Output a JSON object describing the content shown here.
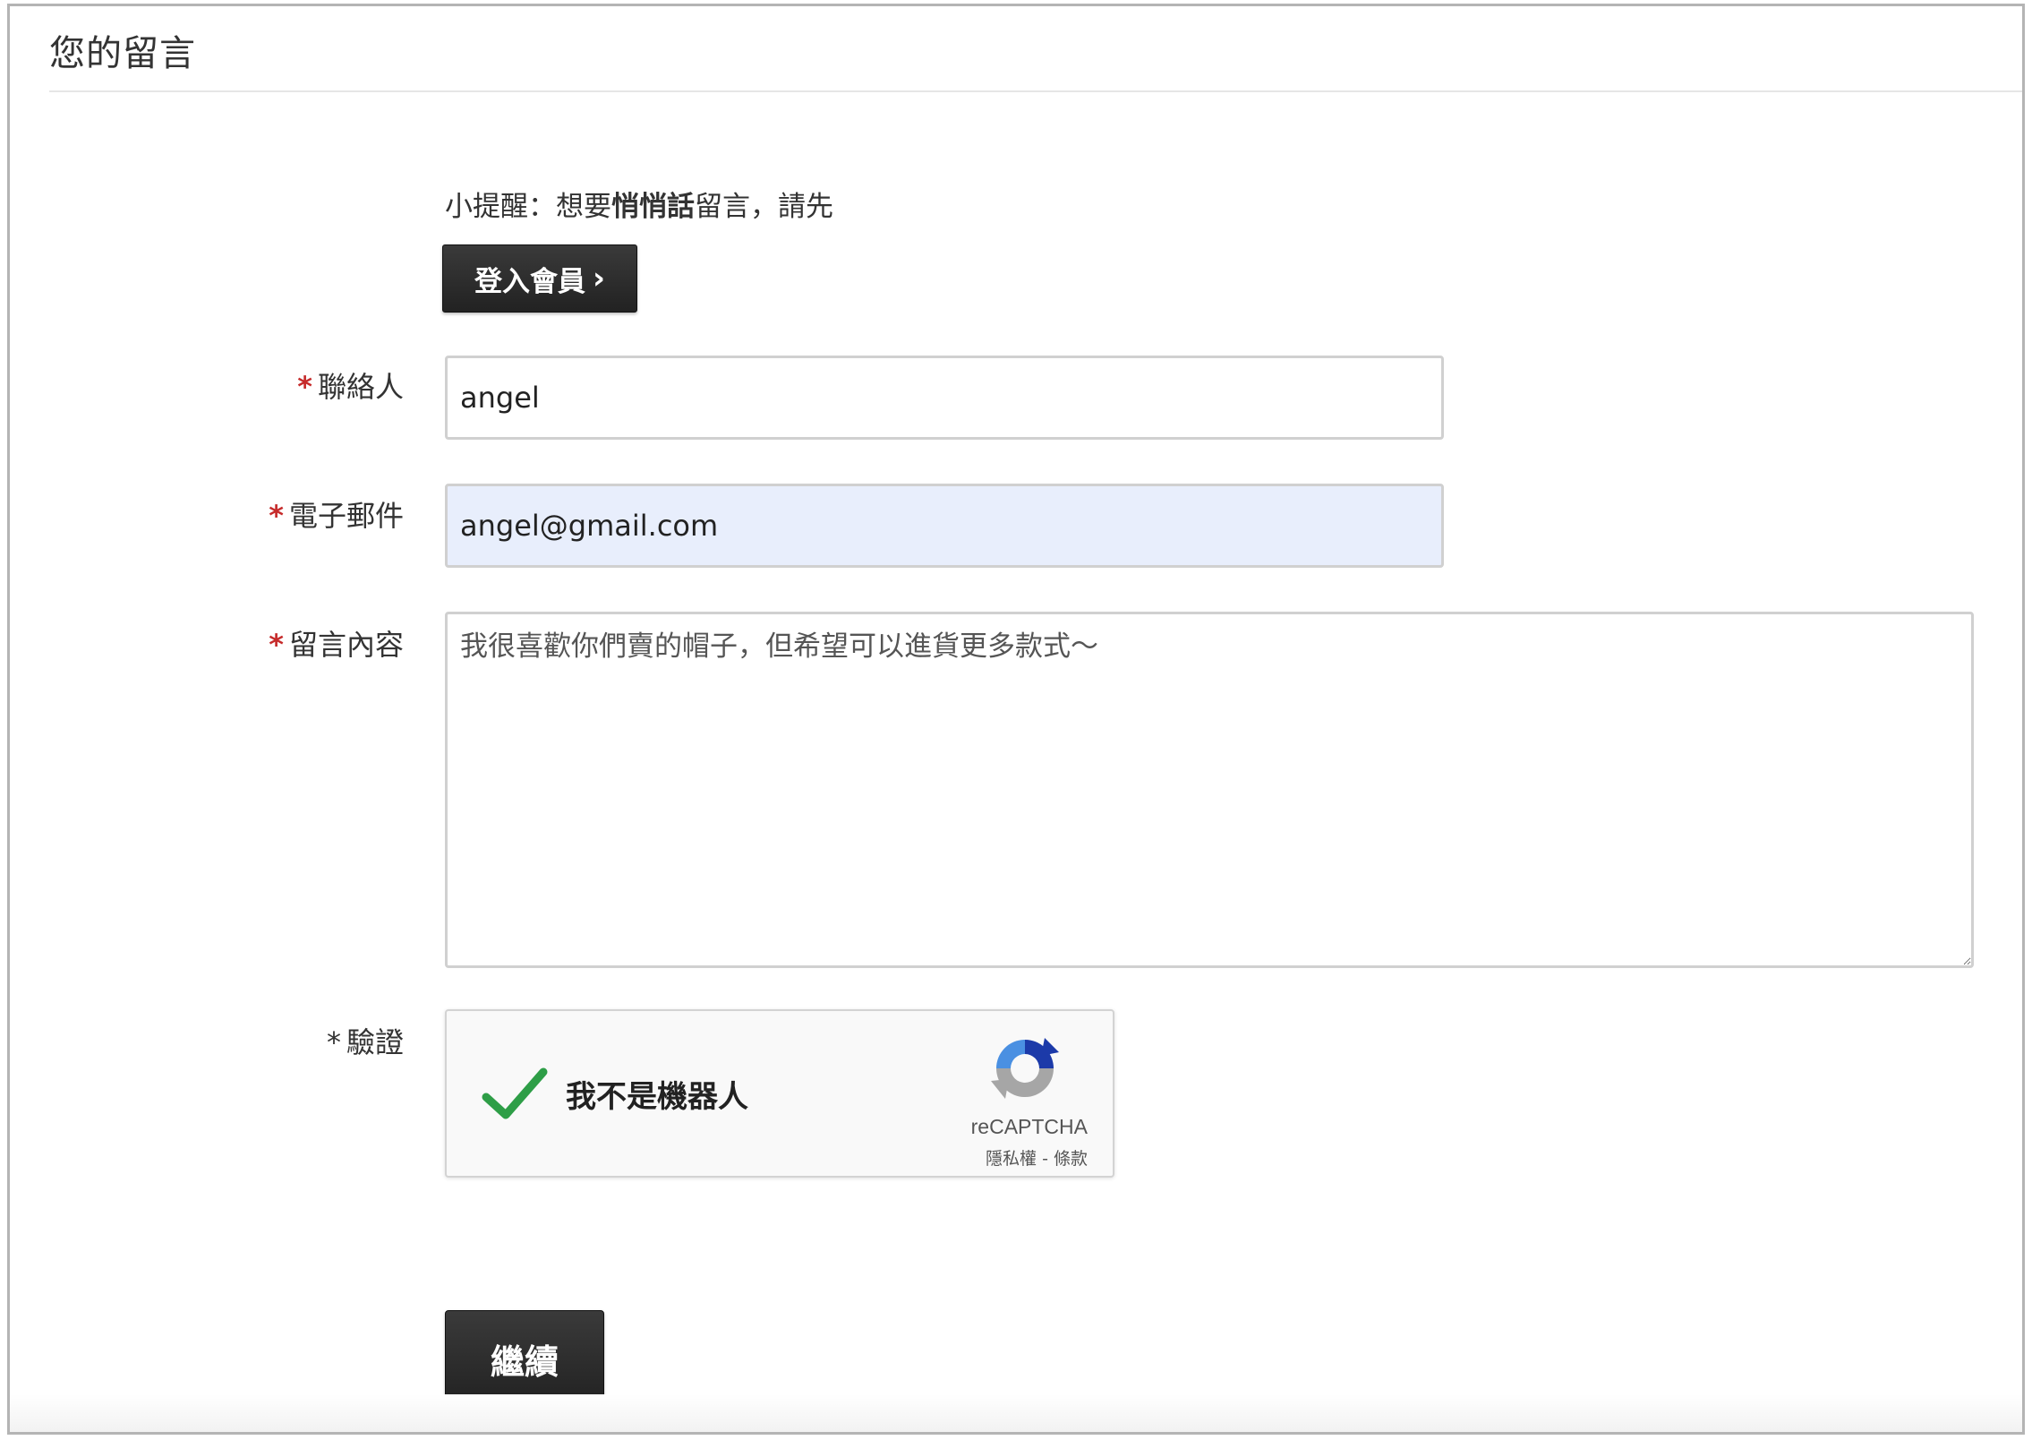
{
  "section": {
    "title": "您的留言"
  },
  "hint": {
    "prefix": "小提醒：想要",
    "emphasis": "悄悄話",
    "suffix": "留言，請先"
  },
  "login_button": {
    "label": "登入會員",
    "chevron": "›"
  },
  "form": {
    "contact": {
      "required_mark": "*",
      "label": "聯絡人",
      "value": "angel"
    },
    "email": {
      "required_mark": "*",
      "label": "電子郵件",
      "value": "angel@gmail.com"
    },
    "message": {
      "required_mark": "*",
      "label": "留言內容",
      "value": "我很喜歡你們賣的帽子，但希望可以進貨更多款式～"
    },
    "verify": {
      "required_mark": "*",
      "label": "驗證"
    }
  },
  "recaptcha": {
    "checkbox_text": "我不是機器人",
    "checked": true,
    "brand": "reCAPTCHA",
    "privacy_link": "隱私權",
    "separator": " - ",
    "terms_link": "條款",
    "check_color": "#2e9e47"
  },
  "submit_button": {
    "label": "繼續"
  },
  "colors": {
    "required": "#c62b2b",
    "button_bg": "#2b2b2b",
    "autofill_bg": "#e8eefc",
    "recaptcha_blue": "#1c3aa9",
    "recaptcha_lightblue": "#4a90e2",
    "recaptcha_gray": "#a6a6a6"
  }
}
